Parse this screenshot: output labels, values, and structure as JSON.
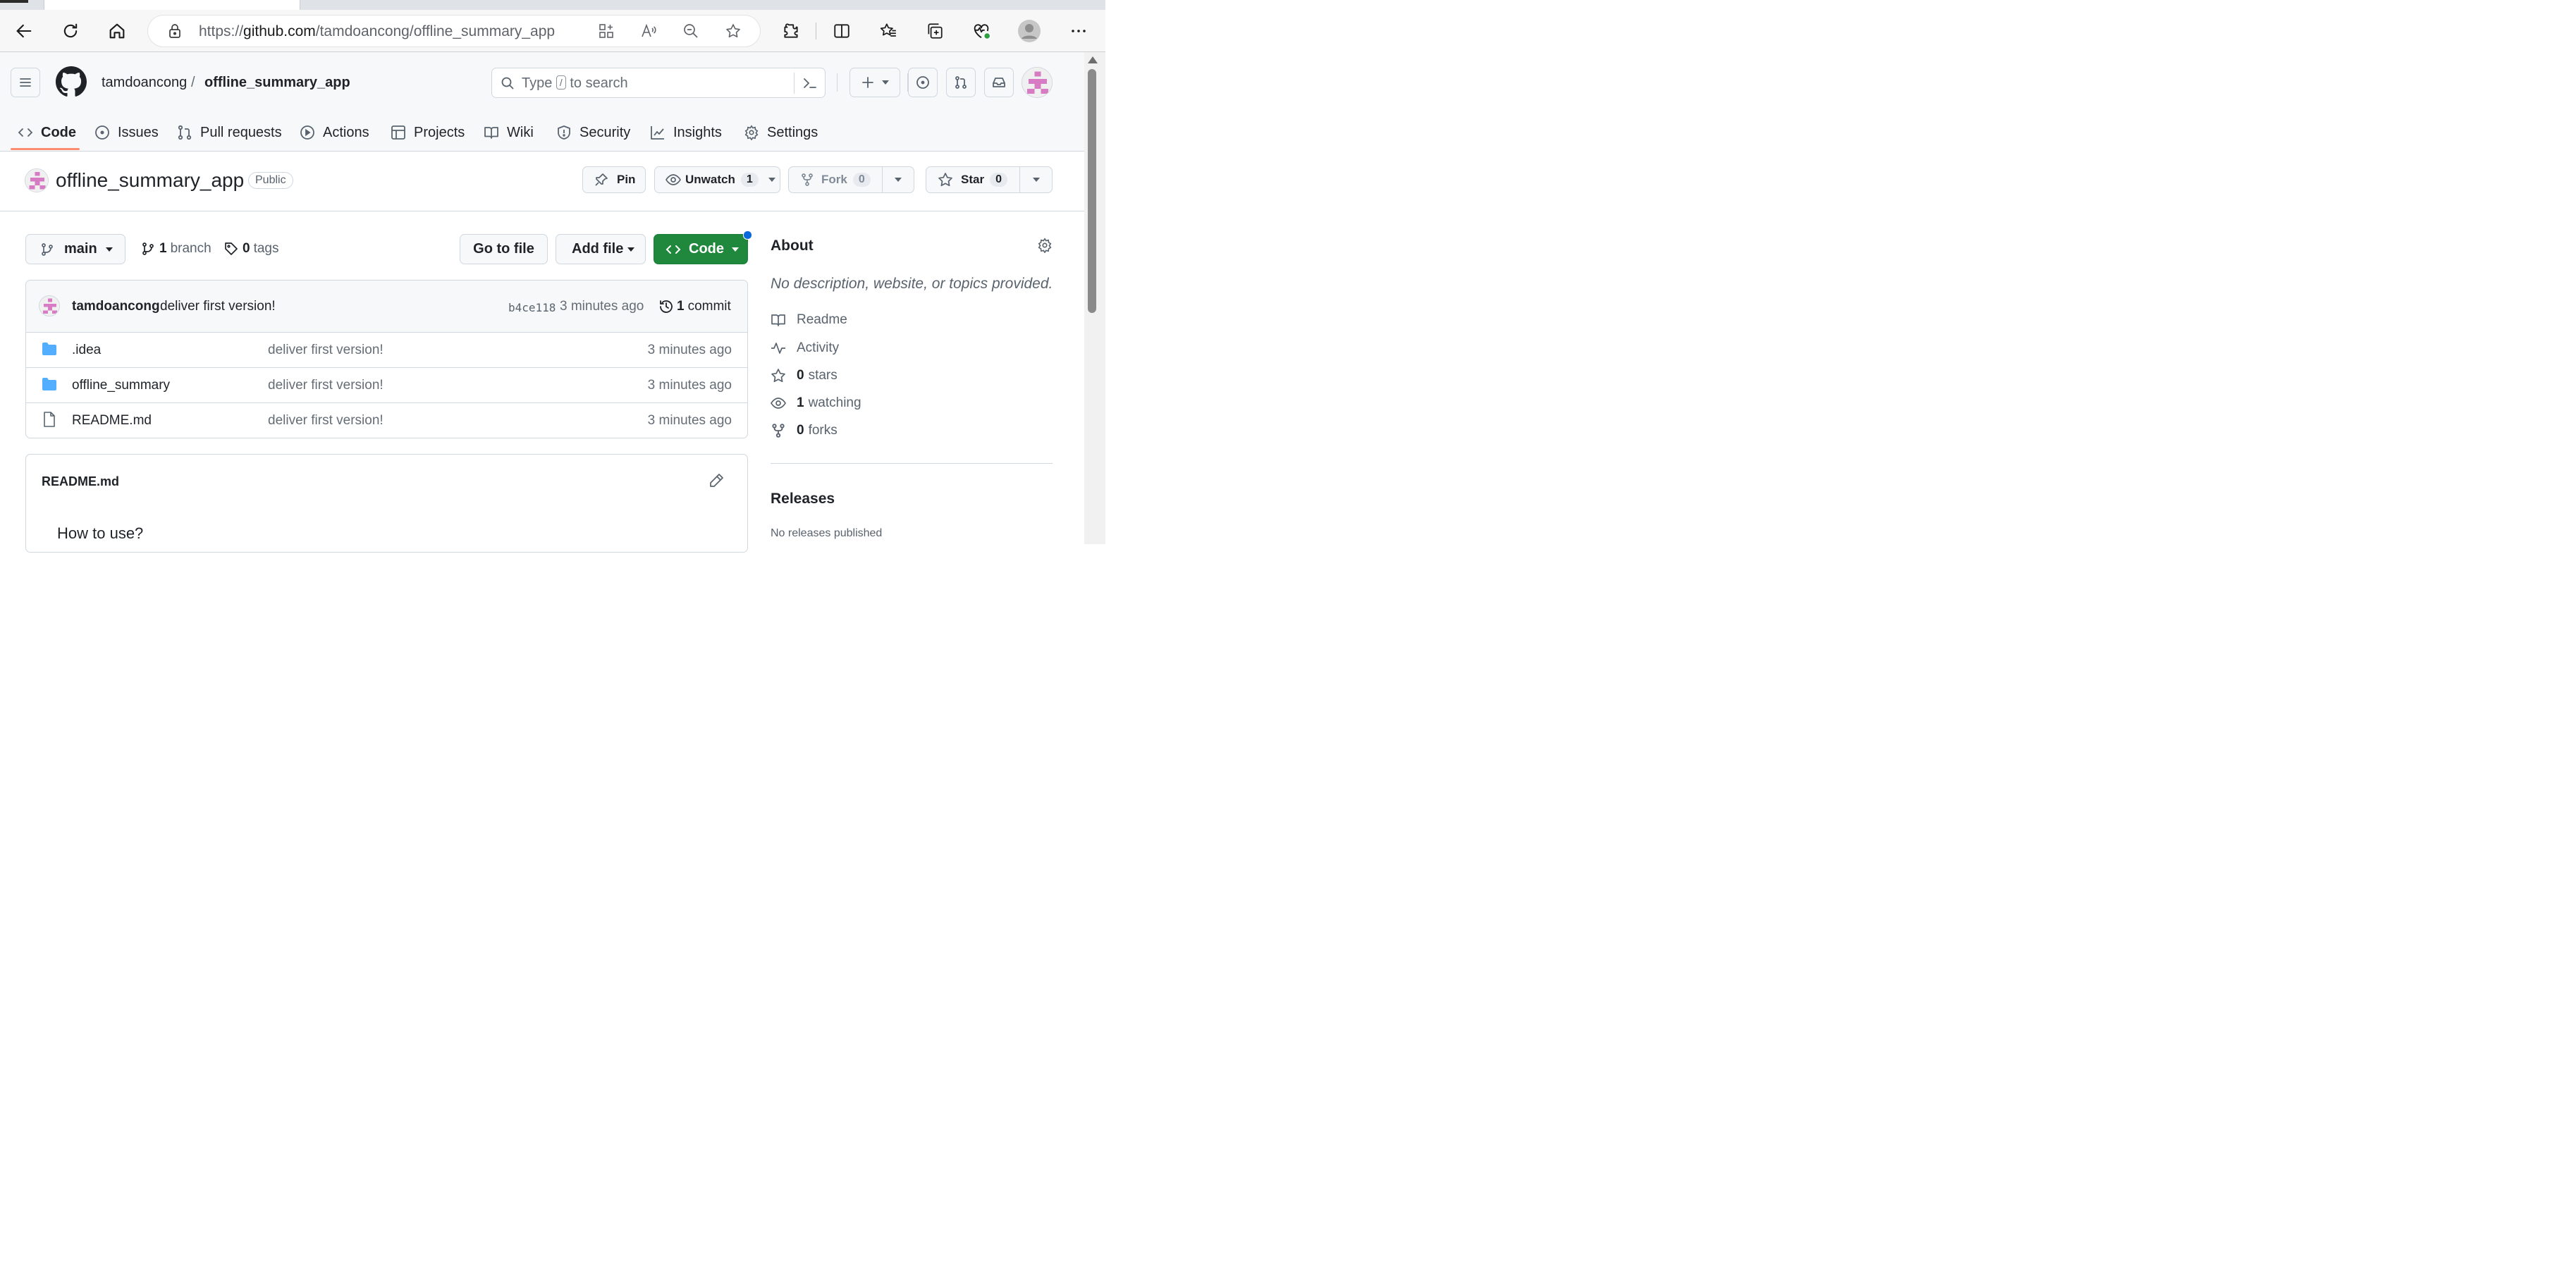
{
  "browser": {
    "url_prefix": "https://",
    "url_host": "github.com",
    "url_path": "/tamdoancong/offline_summary_app"
  },
  "header": {
    "owner": "tamdoancong",
    "separator": "/",
    "repo": "offline_summary_app",
    "search_prefix": "Type",
    "search_key": "/",
    "search_suffix": "to search"
  },
  "nav": {
    "items": [
      {
        "label": "Code",
        "icon": "code-icon"
      },
      {
        "label": "Issues",
        "icon": "issue-icon"
      },
      {
        "label": "Pull requests",
        "icon": "pull-request-icon"
      },
      {
        "label": "Actions",
        "icon": "play-icon"
      },
      {
        "label": "Projects",
        "icon": "table-icon"
      },
      {
        "label": "Wiki",
        "icon": "book-icon"
      },
      {
        "label": "Security",
        "icon": "shield-icon"
      },
      {
        "label": "Insights",
        "icon": "graph-icon"
      },
      {
        "label": "Settings",
        "icon": "gear-icon"
      }
    ]
  },
  "repo": {
    "name": "offline_summary_app",
    "visibility": "Public",
    "pin_label": "Pin",
    "unwatch_label": "Unwatch",
    "watch_count": "1",
    "fork_label": "Fork",
    "fork_count": "0",
    "star_label": "Star",
    "star_count": "0"
  },
  "toolbar": {
    "branch": "main",
    "branch_count": "1",
    "branch_word": "branch",
    "tag_count": "0",
    "tag_word": "tags",
    "go_to_file": "Go to file",
    "add_file": "Add file",
    "code": "Code"
  },
  "commit": {
    "author": "tamdoancong",
    "message": "deliver first version!",
    "sha": "b4ce118",
    "time": "3 minutes ago",
    "count": "1",
    "count_word": "commit"
  },
  "files": [
    {
      "name": ".idea",
      "type": "folder",
      "message": "deliver first version!",
      "age": "3 minutes ago"
    },
    {
      "name": "offline_summary",
      "type": "folder",
      "message": "deliver first version!",
      "age": "3 minutes ago"
    },
    {
      "name": "README.md",
      "type": "file",
      "message": "deliver first version!",
      "age": "3 minutes ago"
    }
  ],
  "readme": {
    "title": "README.md",
    "heading": "How to use?"
  },
  "about": {
    "title": "About",
    "description": "No description, website, or topics provided.",
    "readme_link": "Readme",
    "activity_link": "Activity",
    "stars_count": "0",
    "stars_word": "stars",
    "watching_count": "1",
    "watching_word": "watching",
    "forks_count": "0",
    "forks_word": "forks",
    "releases_title": "Releases",
    "releases_text": "No releases published"
  },
  "colors": {
    "code_button": "#1f883d",
    "nav_underline": "#fd8c73",
    "folder": "#54aeff",
    "avatar": "#d77cc4"
  }
}
